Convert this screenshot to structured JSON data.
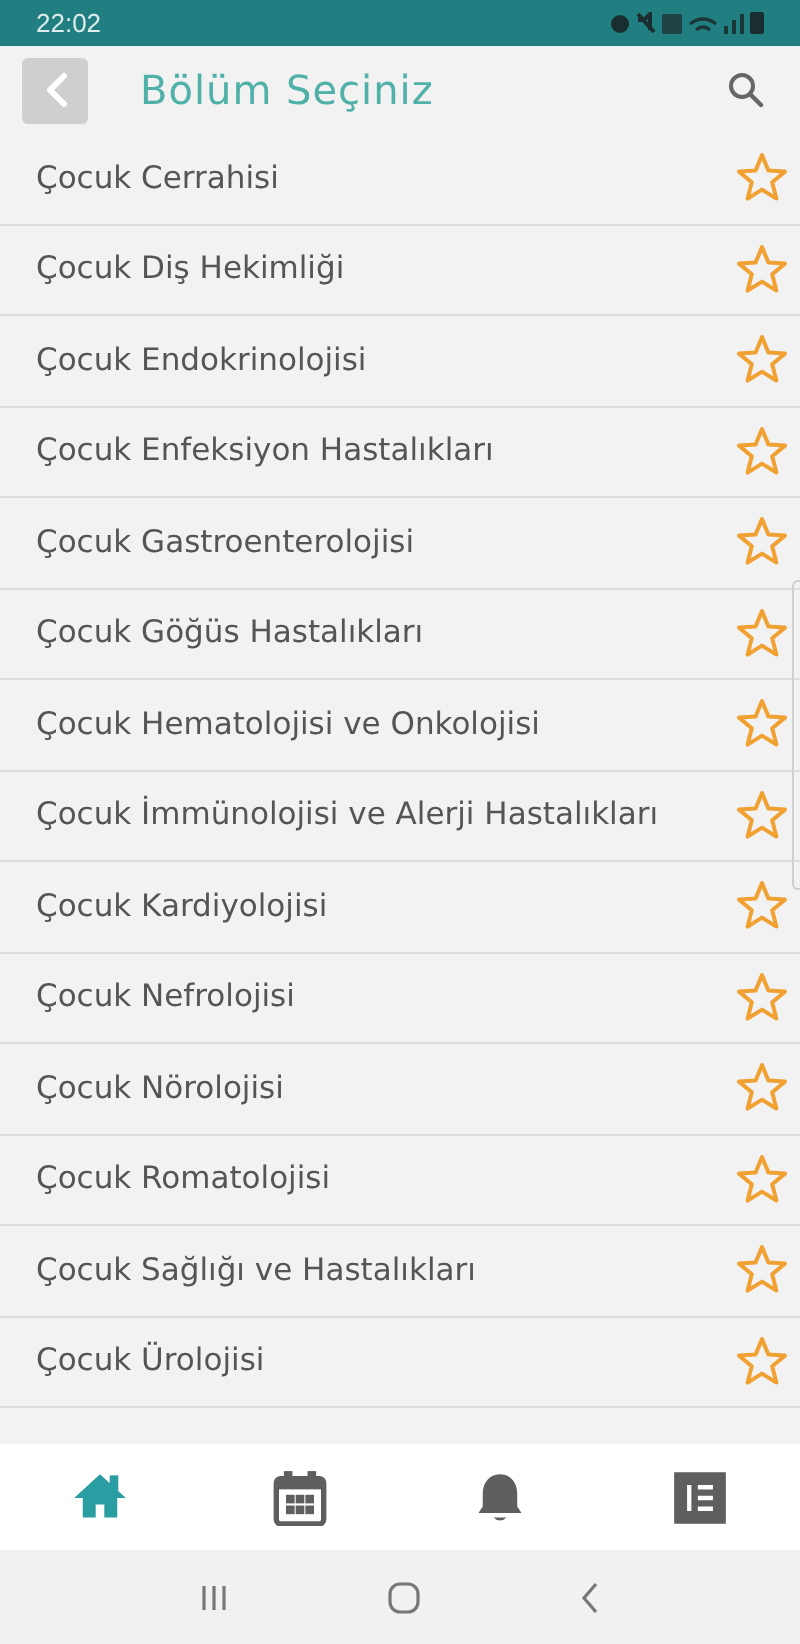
{
  "status_bar": {
    "time": "22:02"
  },
  "header": {
    "title": "Bölüm Seçiniz"
  },
  "departments": [
    {
      "name": "Çocuk Cerrahisi",
      "favorite": false
    },
    {
      "name": "Çocuk Diş Hekimliği",
      "favorite": false
    },
    {
      "name": "Çocuk Endokrinolojisi",
      "favorite": false
    },
    {
      "name": "Çocuk Enfeksiyon Hastalıkları",
      "favorite": false
    },
    {
      "name": "Çocuk Gastroenterolojisi",
      "favorite": false
    },
    {
      "name": "Çocuk Göğüs Hastalıkları",
      "favorite": false
    },
    {
      "name": "Çocuk Hematolojisi ve Onkolojisi",
      "favorite": false
    },
    {
      "name": "Çocuk İmmünolojisi ve Alerji Hastalıkları",
      "favorite": false
    },
    {
      "name": "Çocuk Kardiyolojisi",
      "favorite": false
    },
    {
      "name": "Çocuk Nefrolojisi",
      "favorite": false
    },
    {
      "name": "Çocuk Nörolojisi",
      "favorite": false
    },
    {
      "name": "Çocuk Romatolojisi",
      "favorite": false
    },
    {
      "name": "Çocuk Sağlığı ve Hastalıkları",
      "favorite": false
    },
    {
      "name": "Çocuk Ürolojisi",
      "favorite": false
    }
  ],
  "bottom_nav": [
    {
      "kind": "home",
      "selected": true
    },
    {
      "kind": "calendar",
      "selected": false
    },
    {
      "kind": "bell",
      "selected": false
    },
    {
      "kind": "list",
      "selected": false
    }
  ]
}
